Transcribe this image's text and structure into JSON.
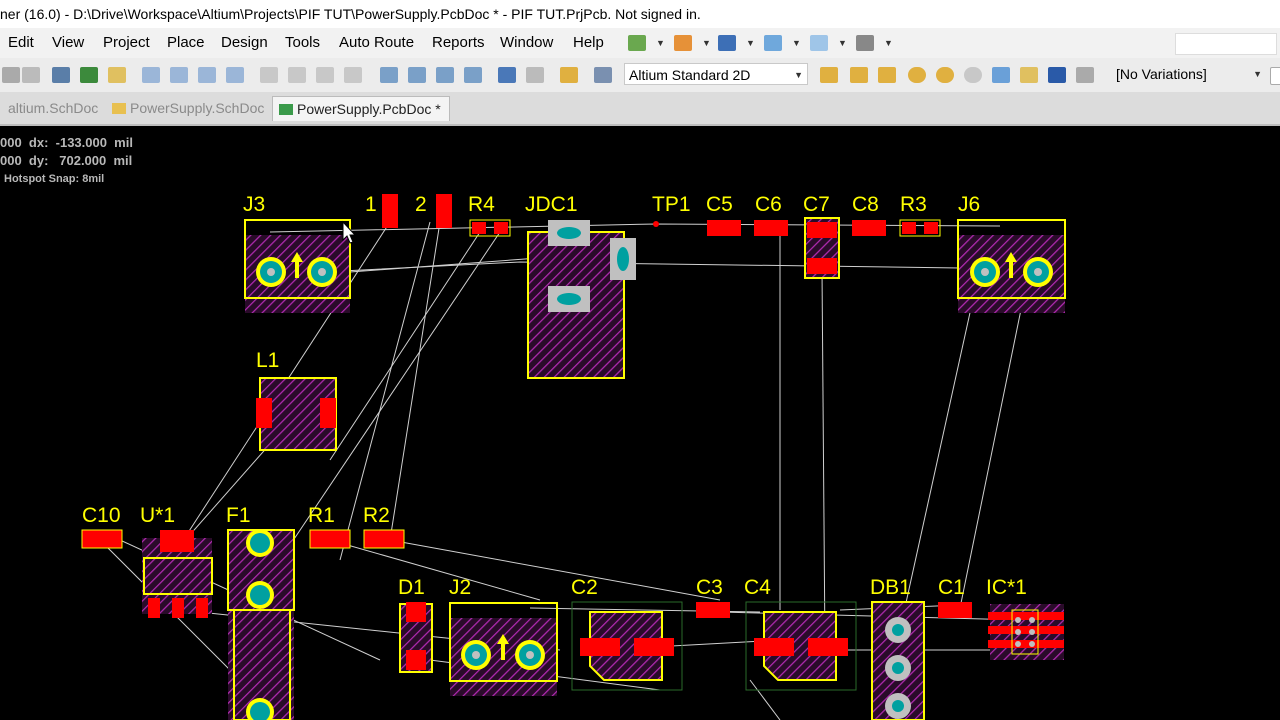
{
  "window": {
    "title": "ner (16.0) - D:\\Drive\\Workspace\\Altium\\Projects\\PIF TUT\\PowerSupply.PcbDoc * - PIF TUT.PrjPcb. Not signed in."
  },
  "menu": [
    "Edit",
    "View",
    "Project",
    "Place",
    "Design",
    "Tools",
    "Auto Route",
    "Reports",
    "Window",
    "Help"
  ],
  "toolbar": {
    "view_mode": "Altium Standard 2D",
    "variations": "[No Variations]"
  },
  "tabs": [
    {
      "label": "altium.SchDoc",
      "active": false
    },
    {
      "label": "PowerSupply.SchDoc",
      "active": false
    },
    {
      "label": "PowerSupply.PcbDoc *",
      "active": true
    }
  ],
  "hud": {
    "line1": "000  dx:  -133.000  mil",
    "line2": "000  dy:   702.000  mil",
    "line3": "Hotspot Snap: 8mil"
  },
  "pcb": {
    "designators": [
      "J3",
      "1",
      "2",
      "R4",
      "JDC1",
      "TP1",
      "C5",
      "C6",
      "C7",
      "C8",
      "R3",
      "J6",
      "L1",
      "C10",
      "U*1",
      "F1",
      "R1",
      "R2",
      "D1",
      "J2",
      "C2",
      "C3",
      "C4",
      "DB1",
      "C1",
      "IC*1"
    ],
    "colors": {
      "background": "#000000",
      "overlay": "#ffff00",
      "pad": "#ff0000",
      "hatch": "#a020a0",
      "via": "#c0c0c0",
      "ratsnest": "#d0d0d0"
    }
  },
  "icons": [
    "interactive-route-icon",
    "align-icon",
    "text-icon",
    "snap-icon",
    "grid-icon",
    "open-icon",
    "zoom-icon",
    "select-icon",
    "move-icon",
    "cut-icon",
    "copy-icon",
    "paste-icon",
    "undo-icon",
    "redo-icon",
    "pad-icon",
    "via-icon",
    "arc-icon",
    "fill-icon",
    "string-icon",
    "component-icon"
  ]
}
